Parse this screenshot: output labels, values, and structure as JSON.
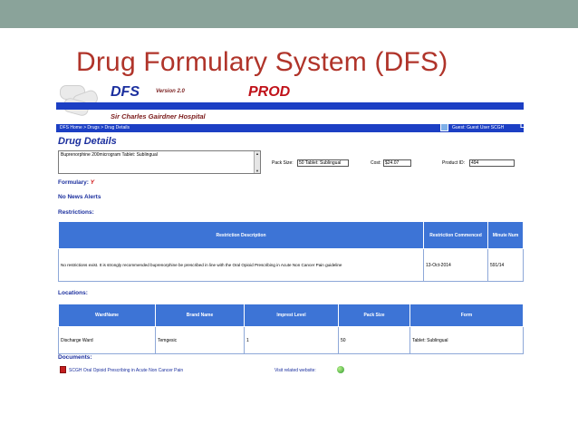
{
  "slide": {
    "title": "Drug Formulary System (DFS)",
    "bar_color": "#8aa39a",
    "title_color": "#b0342a"
  },
  "app": {
    "name": "DFS",
    "version": "Version 2.0",
    "environment": "PROD",
    "hospital": "Sir Charles Gairdner Hospital",
    "accent_color": "#1c3fc4"
  },
  "nav": {
    "breadcrumb": "DFS Home > Drugs > Drug Details",
    "user": "Guest: Guest User SCGH",
    "separator": "L"
  },
  "drug": {
    "heading": "Drug Details",
    "name": "Buprenorphine 200microgram Tablet: Sublingual",
    "pack_size_label": "Pack Size:",
    "pack_size": "50 Tablet: Sublingual",
    "cost_label": "Cost:",
    "cost": "$24.07",
    "product_id_label": "Product ID:",
    "product_id": "494"
  },
  "status": {
    "formulary_label": "Formulary:",
    "formulary_value": "Y",
    "news": "No News Alerts"
  },
  "restrictions": {
    "heading": "Restrictions:",
    "columns": [
      "Restriction Description",
      "Restriction Commenced",
      "Minute Num"
    ],
    "rows": [
      [
        "No restrictions exist. It is strongly recommended buprenorphine be prescribed in line with the Oral Opioid Prescribing in Acute Non Cancer Pain guideline",
        "13-Oct-2014",
        "591/14"
      ]
    ]
  },
  "locations": {
    "heading": "Locations:",
    "columns": [
      "WardName",
      "Brand Name",
      "Imprest Level",
      "Pack Size",
      "Form"
    ],
    "rows": [
      [
        "Discharge Ward",
        "Temgesic",
        "1",
        "50",
        "Tablet: Sublingual"
      ]
    ]
  },
  "documents": {
    "heading": "Documents:",
    "doc_link": "SCGH Oral Opioid Prescribing in Acute Non Cancer Pain",
    "visit_label": "Visit related website:",
    "pdf_icon": "pdf-icon",
    "web_icon": "globe-icon"
  }
}
